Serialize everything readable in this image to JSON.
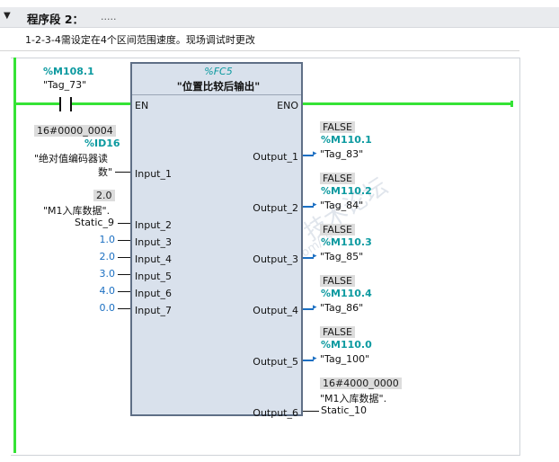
{
  "network": {
    "title": "程序段 2：",
    "title_dots": ".....",
    "comment": "1-2-3-4需设定在4个区间范围速度。现场调试时更改"
  },
  "contact": {
    "address": "%M108.1",
    "symbol": "\"Tag_73\""
  },
  "block": {
    "name": "%FC5",
    "title": "\"位置比较后输出\"",
    "en": "EN",
    "eno": "ENO",
    "inputs": [
      "Input_1",
      "Input_2",
      "Input_3",
      "Input_4",
      "Input_5",
      "Input_6",
      "Input_7"
    ],
    "outputs": [
      "Output_1",
      "Output_2",
      "Output_3",
      "Output_4",
      "Output_5",
      "Output_6"
    ]
  },
  "in1": {
    "value": "16#0000_0004",
    "address": "%ID16",
    "symbol_line1": "\"绝对值编码器读",
    "symbol_line2": "数\""
  },
  "in2": {
    "value": "2.0",
    "symbol_line1": "\"M1入库数据\".",
    "symbol_line2": "Static_9"
  },
  "constants": [
    "1.0",
    "2.0",
    "3.0",
    "4.0",
    "0.0"
  ],
  "out1": {
    "value": "FALSE",
    "address": "%M110.1",
    "symbol": "\"Tag_83\""
  },
  "out2": {
    "value": "FALSE",
    "address": "%M110.2",
    "symbol": "\"Tag_84\""
  },
  "out3": {
    "value": "FALSE",
    "address": "%M110.3",
    "symbol": "\"Tag_85\""
  },
  "out4": {
    "value": "FALSE",
    "address": "%M110.4",
    "symbol": "\"Tag_86\""
  },
  "out5": {
    "value": "FALSE",
    "address": "%M110.0",
    "symbol": "\"Tag_100\""
  },
  "out6": {
    "value": "16#4000_0000",
    "symbol_line1": "\"M1入库数据\".",
    "symbol_line2": "Static_10"
  },
  "watermark": {
    "line1": "西门子工业",
    "line2": "support.industry.siemens.com/cs",
    "line3": "技术论坛"
  }
}
